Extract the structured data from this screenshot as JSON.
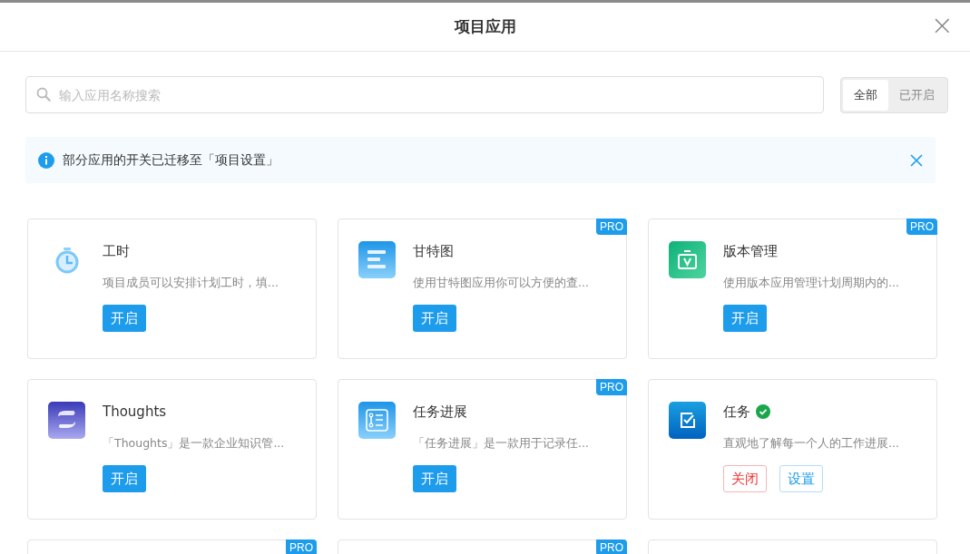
{
  "dialog": {
    "title": "项目应用",
    "close": "×"
  },
  "search": {
    "placeholder": "输入应用名称搜索"
  },
  "filter_tabs": [
    {
      "label": "全部",
      "selected": true
    },
    {
      "label": "已开启",
      "selected": false
    }
  ],
  "notice": {
    "text": "部分应用的开关已迁移至「项目设置」"
  },
  "apps": [
    {
      "kind": "timer",
      "title": "工时",
      "description": "项目成员可以安排计划工时，填...",
      "enabled": false,
      "buttons": [
        {
          "kind": "primary",
          "label": "开启"
        }
      ]
    },
    {
      "kind": "gantt",
      "title": "甘特图",
      "description": "使用甘特图应用你可以方便的查...",
      "badge": "PRO",
      "enabled": false,
      "buttons": [
        {
          "kind": "primary",
          "label": "开启"
        }
      ]
    },
    {
      "kind": "version",
      "title": "版本管理",
      "description": "使用版本应用管理计划周期内的...",
      "badge": "PRO",
      "enabled": false,
      "buttons": [
        {
          "kind": "primary",
          "label": "开启"
        }
      ]
    },
    {
      "kind": "thoughts",
      "title": "Thoughts",
      "description": "「Thoughts」是一款企业知识管...",
      "enabled": false,
      "buttons": [
        {
          "kind": "primary",
          "label": "开启"
        }
      ]
    },
    {
      "kind": "progress",
      "title": "任务进展",
      "description": "「任务进展」是一款用于记录任...",
      "badge": "PRO",
      "enabled": false,
      "buttons": [
        {
          "kind": "primary",
          "label": "开启"
        }
      ]
    },
    {
      "kind": "task",
      "title": "任务",
      "description": "直观地了解每一个人的工作进展...",
      "enabled": true,
      "buttons": [
        {
          "kind": "danger",
          "label": "关闭"
        },
        {
          "kind": "outline",
          "label": "设置"
        }
      ]
    },
    {
      "kind": "empty",
      "badge": "PRO"
    },
    {
      "kind": "empty",
      "badge": "PRO"
    },
    {
      "kind": "empty"
    }
  ]
}
